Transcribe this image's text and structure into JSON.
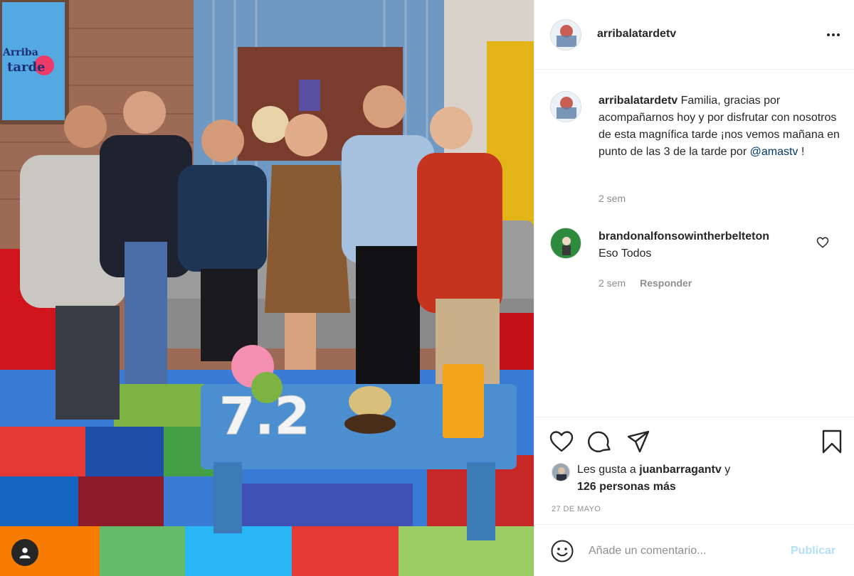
{
  "post": {
    "author": "arribalatardetv",
    "photo_overlay": {
      "show_logo_line1": "Arriba",
      "show_logo_line2": "tarde",
      "table_number": "7.2"
    },
    "caption": {
      "username": "arribalatardetv",
      "text": "Familia, gracias por acompañarnos hoy y por disfrutar con nosotros de esta magnífica tarde ¡nos vemos mañana en punto de las 3 de la tarde por",
      "mention": "@amastv",
      "suffix": " !",
      "time": "2 sem"
    },
    "comments": [
      {
        "username": "brandonalfonsowintherbelteton",
        "text": "Eso Todos",
        "time": "2 sem",
        "reply_label": "Responder"
      }
    ],
    "likes": {
      "prefix": "Les gusta a",
      "liker": "juanbarragantv",
      "connector": "y",
      "others": "126 personas más"
    },
    "date": "27 DE MAYO",
    "add_comment": {
      "placeholder": "Añade un comentario...",
      "publish_label": "Publicar"
    }
  },
  "icons": {
    "more": "more-horizontal-icon",
    "like": "heart-icon",
    "comment": "comment-bubble-icon",
    "share": "paper-plane-icon",
    "save": "bookmark-icon",
    "emoji": "smiley-icon",
    "user_tags": "user-tag-icon"
  },
  "colors": {
    "text": "#262626",
    "secondary": "#8e8e8e",
    "mention": "#00376b",
    "publish_disabled": "#b2dffc",
    "border": "#efefef"
  }
}
